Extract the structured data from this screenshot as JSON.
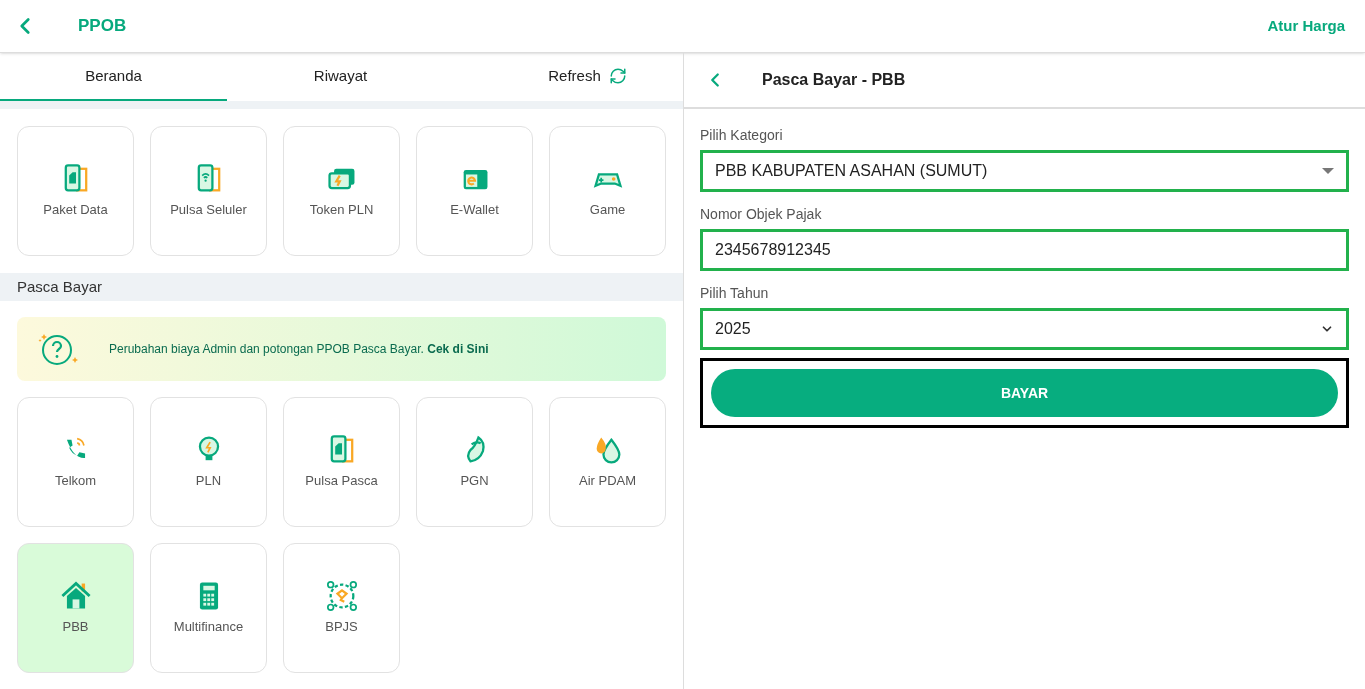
{
  "header": {
    "title": "PPOB",
    "action": "Atur Harga"
  },
  "tabs": [
    {
      "label": "Beranda",
      "selected": true
    },
    {
      "label": "Riwayat",
      "selected": false
    },
    {
      "label": "Refresh",
      "selected": false,
      "kind": "refresh"
    }
  ],
  "prabayar": {
    "items": [
      {
        "label": "Paket Data",
        "kind": "sim",
        "selected": false
      },
      {
        "label": "Pulsa Seluler",
        "kind": "phone",
        "selected": false
      },
      {
        "label": "Token PLN",
        "kind": "token",
        "selected": false
      },
      {
        "label": "E-Wallet",
        "kind": "wallet",
        "selected": false
      },
      {
        "label": "Game",
        "kind": "game",
        "selected": false
      }
    ]
  },
  "pasca_bayar": {
    "title": "Pasca Bayar",
    "banner": "Perubahan biaya Admin dan potongan PPOB Pasca Bayar. **Cek di Sini**",
    "items": [
      {
        "label": "Telkom",
        "kind": "telephone",
        "selected": false
      },
      {
        "label": "PLN",
        "kind": "bulb",
        "selected": false
      },
      {
        "label": "Pulsa Pasca",
        "kind": "sim",
        "selected": false
      },
      {
        "label": "PGN",
        "kind": "flame",
        "selected": false
      },
      {
        "label": "Air PDAM",
        "kind": "drop",
        "selected": false
      },
      {
        "label": "PBB",
        "kind": "house",
        "selected": true
      },
      {
        "label": "Multifinance",
        "kind": "calculator",
        "selected": false
      },
      {
        "label": "BPJS",
        "kind": "bpjs",
        "selected": false
      }
    ]
  },
  "form": {
    "title": "Pasca Bayar - PBB",
    "fields": [
      {
        "label": "Pilih Kategori",
        "value": "PBB KABUPATEN ASAHAN (SUMUT)",
        "kind": "select",
        "highlighted": true
      },
      {
        "label": "Nomor Objek Pajak",
        "value": "2345678912345",
        "kind": "input",
        "highlighted": true
      },
      {
        "label": "Pilih Tahun",
        "value": "2025",
        "kind": "year",
        "highlighted": true
      }
    ],
    "submit": {
      "label": "BAYAR",
      "highlighted": true
    }
  }
}
